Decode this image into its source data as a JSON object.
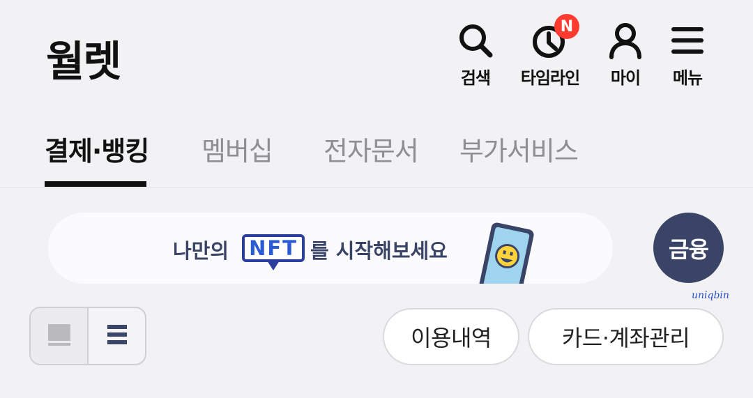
{
  "header": {
    "title": "월렛",
    "actions": [
      {
        "label": "검색",
        "icon": "search-icon"
      },
      {
        "label": "타임라인",
        "icon": "clock-icon",
        "badge": "N"
      },
      {
        "label": "마이",
        "icon": "person-icon"
      },
      {
        "label": "메뉴",
        "icon": "menu-icon"
      }
    ]
  },
  "tabs": [
    {
      "label": "결제·뱅킹",
      "active": true
    },
    {
      "label": "멤버십",
      "active": false
    },
    {
      "label": "전자문서",
      "active": false
    },
    {
      "label": "부가서비스",
      "active": false
    }
  ],
  "banner": {
    "text_before": "나만의",
    "highlight": "NFT",
    "text_after": "를 시작해보세요"
  },
  "finance_button": "금융",
  "watermark": "uniqbin",
  "view_toggle": {
    "options": [
      "card-view-icon",
      "list-view-icon"
    ],
    "selected": "card-view-icon"
  },
  "pills": [
    {
      "label": "이용내역"
    },
    {
      "label": "카드·계좌관리"
    }
  ],
  "colors": {
    "badge": "#ff3b30",
    "accent": "#3a4466",
    "nft_blue": "#2b5cd6"
  }
}
